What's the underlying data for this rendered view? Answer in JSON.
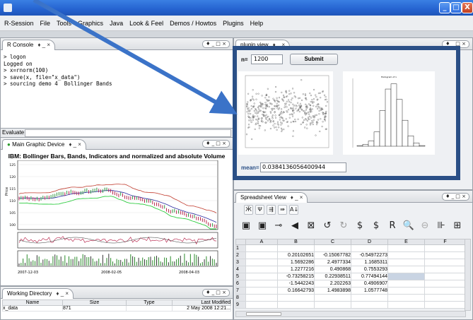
{
  "window": {
    "controls": [
      "_",
      "□",
      "X"
    ]
  },
  "menubar": [
    "R-Session",
    "File",
    "Tools",
    "Graphics",
    "Java",
    "Look & Feel",
    "Demos / Howtos",
    "Plugins",
    "Help"
  ],
  "console": {
    "tab_label": "R Console",
    "tab_icons": "♦ _ ×",
    "window_ctrls": "♦ _ □ ×",
    "lines": [
      "> logon",
      "Logged on",
      "> x=rnorm(100)",
      "> save(x, file=\"x_data\")",
      "> sourcing demo 4  Bollinger Bands"
    ],
    "evaluate_label": "Evaluate :"
  },
  "graphic_device": {
    "tab_label": "Main Graphic Device",
    "tab_icons": "♦ _ ×",
    "window_ctrls": "♦ _ □ ×",
    "title": "IBM: Bollinger Bars, Bands, Indicators and normalized and absolute Volume",
    "y_ticks": [
      "125",
      "120",
      "115",
      "110",
      "105",
      "100"
    ],
    "ylabel": "Price",
    "x_ticks": [
      "2007-12-03",
      "2008-02-05",
      "2008-04-03"
    ],
    "colors": {
      "price_up": "#1a8a2a",
      "price_down": "#b0103a",
      "band_upper": "#c0392b",
      "band_lower": "#2ecc40",
      "mavg": "#2a2aa0"
    }
  },
  "working_directory": {
    "tab_label": "Working Directory",
    "tab_icons": "♦ _ ×",
    "window_ctrls": "♦ _ □ ×",
    "columns": [
      "Name",
      "Size",
      "Type",
      "Last Modified"
    ],
    "rows": [
      [
        "x_data",
        "871",
        "",
        "2 May 2008 12:21..."
      ]
    ]
  },
  "plugin": {
    "tab_label": "plugin view",
    "tab_icons": "♦ _ ×",
    "window_ctrls": "♦ _ □ ×",
    "n_label": "n=",
    "n_value": "1200",
    "submit_label": "Submit",
    "mean_label": "mean=",
    "mean_value": "0.0384136056400944",
    "histogram_title": "Histogram of x",
    "colors": {
      "accent": "#2a4f86",
      "arrow": "#3b73c8"
    }
  },
  "spreadsheet": {
    "tab_label": "Spreadsheet View",
    "tab_icons": "♦ _ ×",
    "window_ctrls": "♦ _ □ ×",
    "columns": [
      "",
      "A",
      "B",
      "C",
      "D",
      "E",
      "F"
    ],
    "rows": [
      [
        "1",
        "",
        "",
        "",
        "",
        "",
        ""
      ],
      [
        "2",
        "",
        "0.20102651",
        "-0.15067782",
        "-0.54972273",
        "",
        ""
      ],
      [
        "3",
        "",
        "1.5692286",
        "2.4977334",
        "1.1685311",
        "",
        ""
      ],
      [
        "4",
        "",
        "1.2277216",
        "0.490868",
        "0.7553293",
        "",
        ""
      ],
      [
        "5",
        "",
        "-0.73258215",
        "0.22938511",
        "0.77494144",
        "",
        ""
      ],
      [
        "6",
        "",
        "-1.5442243",
        "2.202263",
        "0.4906907",
        "",
        ""
      ],
      [
        "7",
        "",
        "0.16642793",
        "1.4983898",
        "1.0577748",
        "",
        ""
      ],
      [
        "8",
        "",
        "",
        "",
        "",
        "",
        ""
      ],
      [
        "9",
        "",
        "",
        "",
        "",
        "",
        ""
      ]
    ],
    "toolbar1": [
      "Ӂ",
      "Ψ",
      "⇶",
      "⇛",
      "A↓"
    ],
    "toolbar2": [
      "▣",
      "▣",
      "⊸",
      "◀",
      "⊠",
      "↺",
      "↻",
      "$",
      "$",
      "R",
      "🔍",
      "⊖",
      "⊪",
      "⊞"
    ]
  }
}
